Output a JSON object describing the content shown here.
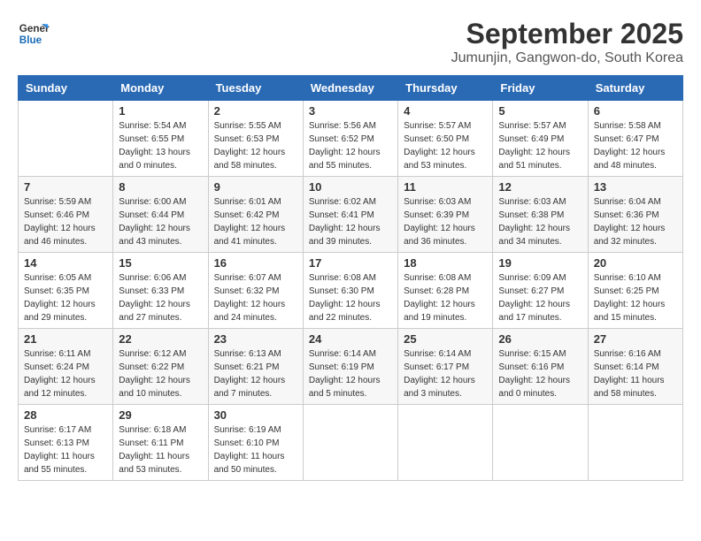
{
  "logo": {
    "line1": "General",
    "line2": "Blue"
  },
  "title": "September 2025",
  "subtitle": "Jumunjin, Gangwon-do, South Korea",
  "headers": [
    "Sunday",
    "Monday",
    "Tuesday",
    "Wednesday",
    "Thursday",
    "Friday",
    "Saturday"
  ],
  "weeks": [
    [
      {
        "day": "",
        "info": ""
      },
      {
        "day": "1",
        "info": "Sunrise: 5:54 AM\nSunset: 6:55 PM\nDaylight: 13 hours\nand 0 minutes."
      },
      {
        "day": "2",
        "info": "Sunrise: 5:55 AM\nSunset: 6:53 PM\nDaylight: 12 hours\nand 58 minutes."
      },
      {
        "day": "3",
        "info": "Sunrise: 5:56 AM\nSunset: 6:52 PM\nDaylight: 12 hours\nand 55 minutes."
      },
      {
        "day": "4",
        "info": "Sunrise: 5:57 AM\nSunset: 6:50 PM\nDaylight: 12 hours\nand 53 minutes."
      },
      {
        "day": "5",
        "info": "Sunrise: 5:57 AM\nSunset: 6:49 PM\nDaylight: 12 hours\nand 51 minutes."
      },
      {
        "day": "6",
        "info": "Sunrise: 5:58 AM\nSunset: 6:47 PM\nDaylight: 12 hours\nand 48 minutes."
      }
    ],
    [
      {
        "day": "7",
        "info": "Sunrise: 5:59 AM\nSunset: 6:46 PM\nDaylight: 12 hours\nand 46 minutes."
      },
      {
        "day": "8",
        "info": "Sunrise: 6:00 AM\nSunset: 6:44 PM\nDaylight: 12 hours\nand 43 minutes."
      },
      {
        "day": "9",
        "info": "Sunrise: 6:01 AM\nSunset: 6:42 PM\nDaylight: 12 hours\nand 41 minutes."
      },
      {
        "day": "10",
        "info": "Sunrise: 6:02 AM\nSunset: 6:41 PM\nDaylight: 12 hours\nand 39 minutes."
      },
      {
        "day": "11",
        "info": "Sunrise: 6:03 AM\nSunset: 6:39 PM\nDaylight: 12 hours\nand 36 minutes."
      },
      {
        "day": "12",
        "info": "Sunrise: 6:03 AM\nSunset: 6:38 PM\nDaylight: 12 hours\nand 34 minutes."
      },
      {
        "day": "13",
        "info": "Sunrise: 6:04 AM\nSunset: 6:36 PM\nDaylight: 12 hours\nand 32 minutes."
      }
    ],
    [
      {
        "day": "14",
        "info": "Sunrise: 6:05 AM\nSunset: 6:35 PM\nDaylight: 12 hours\nand 29 minutes."
      },
      {
        "day": "15",
        "info": "Sunrise: 6:06 AM\nSunset: 6:33 PM\nDaylight: 12 hours\nand 27 minutes."
      },
      {
        "day": "16",
        "info": "Sunrise: 6:07 AM\nSunset: 6:32 PM\nDaylight: 12 hours\nand 24 minutes."
      },
      {
        "day": "17",
        "info": "Sunrise: 6:08 AM\nSunset: 6:30 PM\nDaylight: 12 hours\nand 22 minutes."
      },
      {
        "day": "18",
        "info": "Sunrise: 6:08 AM\nSunset: 6:28 PM\nDaylight: 12 hours\nand 19 minutes."
      },
      {
        "day": "19",
        "info": "Sunrise: 6:09 AM\nSunset: 6:27 PM\nDaylight: 12 hours\nand 17 minutes."
      },
      {
        "day": "20",
        "info": "Sunrise: 6:10 AM\nSunset: 6:25 PM\nDaylight: 12 hours\nand 15 minutes."
      }
    ],
    [
      {
        "day": "21",
        "info": "Sunrise: 6:11 AM\nSunset: 6:24 PM\nDaylight: 12 hours\nand 12 minutes."
      },
      {
        "day": "22",
        "info": "Sunrise: 6:12 AM\nSunset: 6:22 PM\nDaylight: 12 hours\nand 10 minutes."
      },
      {
        "day": "23",
        "info": "Sunrise: 6:13 AM\nSunset: 6:21 PM\nDaylight: 12 hours\nand 7 minutes."
      },
      {
        "day": "24",
        "info": "Sunrise: 6:14 AM\nSunset: 6:19 PM\nDaylight: 12 hours\nand 5 minutes."
      },
      {
        "day": "25",
        "info": "Sunrise: 6:14 AM\nSunset: 6:17 PM\nDaylight: 12 hours\nand 3 minutes."
      },
      {
        "day": "26",
        "info": "Sunrise: 6:15 AM\nSunset: 6:16 PM\nDaylight: 12 hours\nand 0 minutes."
      },
      {
        "day": "27",
        "info": "Sunrise: 6:16 AM\nSunset: 6:14 PM\nDaylight: 11 hours\nand 58 minutes."
      }
    ],
    [
      {
        "day": "28",
        "info": "Sunrise: 6:17 AM\nSunset: 6:13 PM\nDaylight: 11 hours\nand 55 minutes."
      },
      {
        "day": "29",
        "info": "Sunrise: 6:18 AM\nSunset: 6:11 PM\nDaylight: 11 hours\nand 53 minutes."
      },
      {
        "day": "30",
        "info": "Sunrise: 6:19 AM\nSunset: 6:10 PM\nDaylight: 11 hours\nand 50 minutes."
      },
      {
        "day": "",
        "info": ""
      },
      {
        "day": "",
        "info": ""
      },
      {
        "day": "",
        "info": ""
      },
      {
        "day": "",
        "info": ""
      }
    ]
  ]
}
